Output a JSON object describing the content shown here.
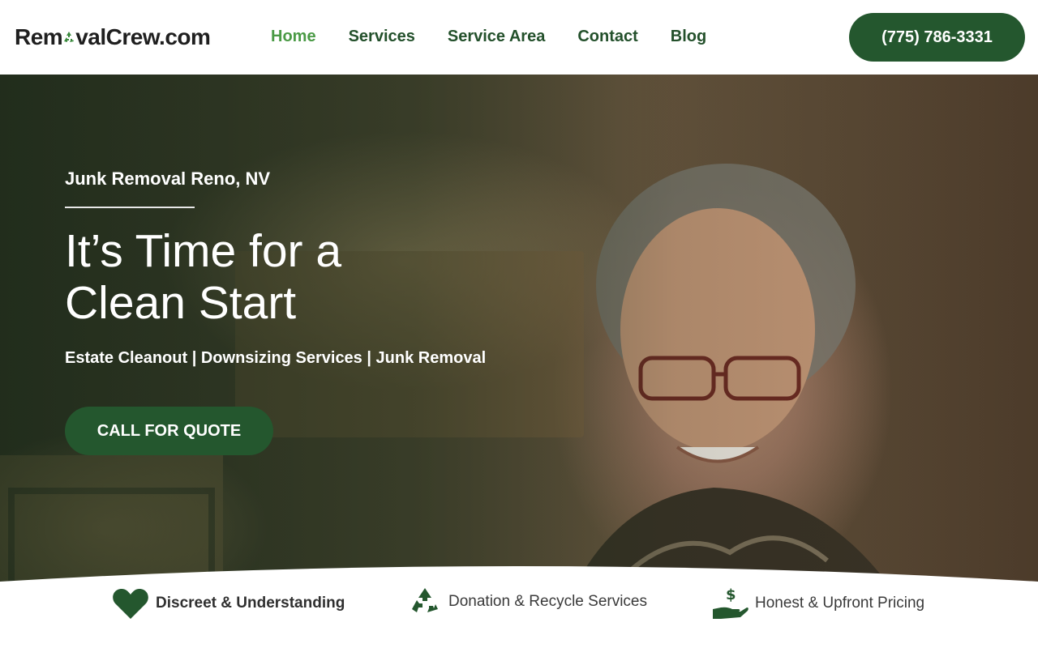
{
  "header": {
    "logo_text_pre": "Rem",
    "logo_text_post": "valCrew.com",
    "nav": [
      {
        "label": "Home",
        "active": true
      },
      {
        "label": "Services",
        "active": false
      },
      {
        "label": "Service Area",
        "active": false
      },
      {
        "label": "Contact",
        "active": false
      },
      {
        "label": "Blog",
        "active": false
      }
    ],
    "phone": "(775) 786-3331"
  },
  "hero": {
    "kicker": "Junk Removal Reno, NV",
    "headline_line1": "It’s Time for a",
    "headline_line2": "Clean Start",
    "services": "Estate Cleanout | Downsizing Services | Junk Removal",
    "cta": "CALL FOR QUOTE"
  },
  "features": [
    {
      "label": "Discreet & Understanding",
      "icon": "heart-icon"
    },
    {
      "label": "Donation & Recycle Services",
      "icon": "recycle-icon"
    },
    {
      "label": "Honest & Upfront Pricing",
      "icon": "dollar-hand-icon"
    }
  ],
  "colors": {
    "brand_green": "#24572e",
    "nav_active": "#4a9a45",
    "nav_text": "#23502b"
  }
}
